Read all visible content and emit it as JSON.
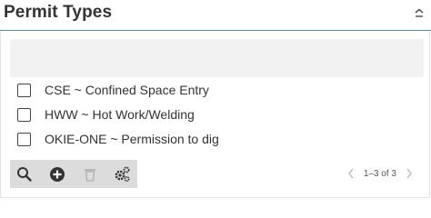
{
  "header": {
    "title": "Permit Types"
  },
  "filter": {
    "placeholder": ""
  },
  "items": [
    {
      "label": "CSE ~ Confined Space Entry",
      "checked": false
    },
    {
      "label": "HWW ~ Hot Work/Welding",
      "checked": false
    },
    {
      "label": "OKIE-ONE ~ Permission to dig",
      "checked": false
    }
  ],
  "toolbar": {
    "icons": [
      "search-icon",
      "add-icon",
      "delete-icon",
      "settings-icon"
    ]
  },
  "pager": {
    "range": "1–3 of 3"
  },
  "colors": {
    "accent_border": "#4a90d9",
    "toolbar_bg": "#dcdcdc",
    "filter_bg": "#f2f2f2"
  }
}
